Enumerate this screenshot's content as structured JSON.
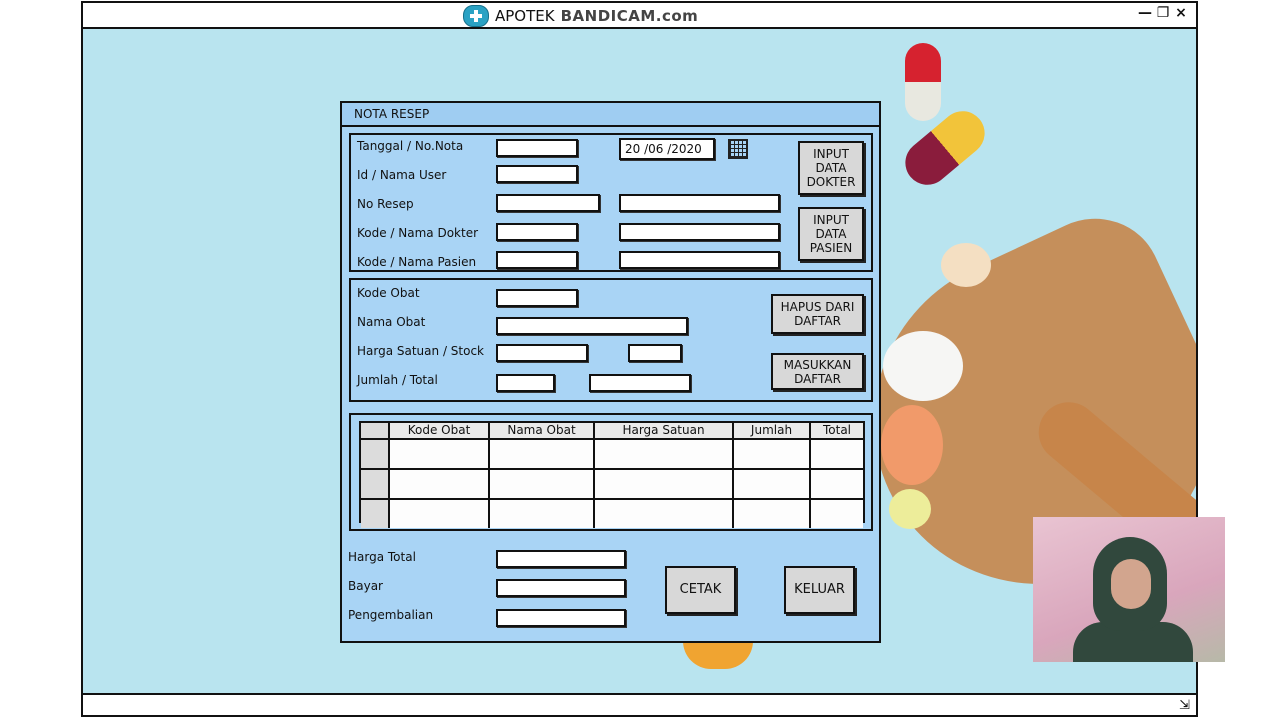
{
  "window": {
    "title": "APOTEK",
    "watermark": "BANDICAM.com",
    "controls": [
      "—",
      "❐",
      "×"
    ],
    "resize_glyph": "⇲"
  },
  "form": {
    "title": "NOTA RESEP",
    "header_labels": {
      "tanggal": "Tanggal / No.Nota",
      "user": "Id / Nama User",
      "resep": "No Resep",
      "dokter": "Kode / Nama Dokter",
      "pasien": "Kode / Nama Pasien"
    },
    "date_value": "20 /06 /2020",
    "buttons": {
      "input_dokter": "INPUT DATA DOKTER",
      "input_pasien": "INPUT DATA PASIEN",
      "hapus": "HAPUS DARI DAFTAR",
      "masukkan": "MASUKKAN DAFTAR",
      "cetak": "CETAK",
      "keluar": "KELUAR"
    },
    "obat_labels": {
      "kode": "Kode Obat",
      "nama": "Nama Obat",
      "harga": "Harga Satuan / Stock",
      "jumlah": "Jumlah / Total"
    },
    "table": {
      "columns": [
        "",
        "Kode Obat",
        "Nama Obat",
        "Harga Satuan",
        "Jumlah",
        "Total"
      ],
      "rows": [
        [
          "",
          "",
          "",
          "",
          "",
          ""
        ],
        [
          "",
          "",
          "",
          "",
          "",
          ""
        ],
        [
          "",
          "",
          "",
          "",
          "",
          ""
        ]
      ]
    },
    "footer_labels": {
      "harga_total": "Harga Total",
      "bayar": "Bayar",
      "pengembalian": "Pengembalian"
    }
  },
  "colors": {
    "background": "#b9e4ef",
    "panel": "#a9d4f5",
    "button": "#d8d8d8"
  }
}
